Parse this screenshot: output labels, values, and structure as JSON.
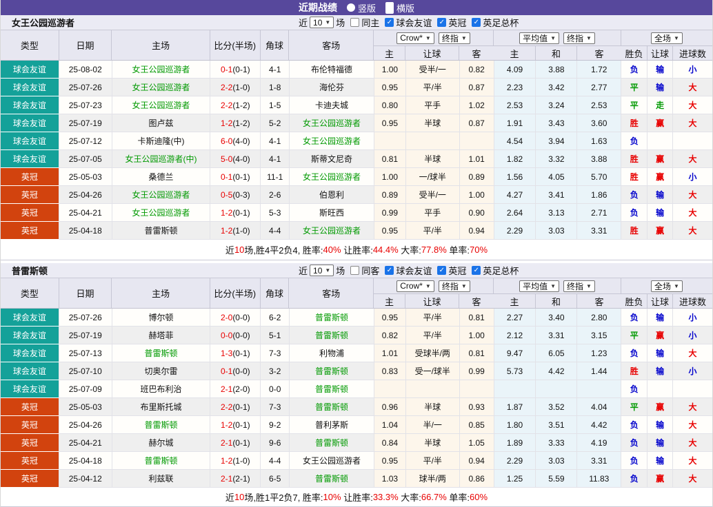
{
  "topbar": {
    "title": "近期战绩",
    "radios": [
      {
        "label": "竖版",
        "selected": false
      },
      {
        "label": "横版",
        "selected": true
      }
    ]
  },
  "columns": {
    "base": [
      "类型",
      "日期",
      "主场",
      "比分(半场)",
      "角球",
      "客场"
    ],
    "odds_group": {
      "dropdown1": "Crow*",
      "dropdown2": "终指",
      "subs": [
        "主",
        "让球",
        "客"
      ]
    },
    "avg_group": {
      "dropdown1": "平均值",
      "dropdown2": "终指",
      "subs": [
        "主",
        "和",
        "客"
      ]
    },
    "result_group": {
      "dropdown": "全场",
      "subs": [
        "胜负",
        "让球",
        "进球数"
      ]
    }
  },
  "colors": {
    "accent_purple": "#57489c",
    "checkbox_blue": "#1a73e8",
    "team_green": "#009900",
    "score_red": "#e80000",
    "badge": {
      "球会友谊": "#14a199",
      "英冠": "#d2430e"
    },
    "result": {
      "胜": "#e80000",
      "平": "#009900",
      "负": "#0000cc",
      "赢": "#e80000",
      "走": "#009900",
      "输": "#0000cc",
      "大": "#e80000",
      "小": "#0000cc"
    }
  },
  "tables": [
    {
      "team": "女王公园巡游者",
      "filter": {
        "prefix": "近",
        "games": "10",
        "suffix": "场",
        "same_label": "同主",
        "same_checked": false,
        "leagues": [
          {
            "label": "球会友谊",
            "checked": true
          },
          {
            "label": "英冠",
            "checked": true
          },
          {
            "label": "英足总杯",
            "checked": true
          }
        ]
      },
      "rows": [
        {
          "type": "球会友谊",
          "date": "25-08-02",
          "home": "女王公园巡游者",
          "home_focus": true,
          "score": "0-1",
          "half": "(0-1)",
          "corner": "4-1",
          "away": "布伦特福德",
          "away_focus": false,
          "crow_home": "1.00",
          "crow_handicap": "受半/一",
          "crow_away": "0.82",
          "avg_home": "4.09",
          "avg_draw": "3.88",
          "avg_away": "1.72",
          "result": "负",
          "handicap_result": "输",
          "goals": "小"
        },
        {
          "type": "球会友谊",
          "date": "25-07-26",
          "home": "女王公园巡游者",
          "home_focus": true,
          "score": "2-2",
          "half": "(1-0)",
          "corner": "1-8",
          "away": "海伦芬",
          "away_focus": false,
          "crow_home": "0.95",
          "crow_handicap": "平/半",
          "crow_away": "0.87",
          "avg_home": "2.23",
          "avg_draw": "3.42",
          "avg_away": "2.77",
          "result": "平",
          "handicap_result": "输",
          "goals": "大"
        },
        {
          "type": "球会友谊",
          "date": "25-07-23",
          "home": "女王公园巡游者",
          "home_focus": true,
          "score": "2-2",
          "half": "(1-2)",
          "corner": "1-5",
          "away": "卡迪夫城",
          "away_focus": false,
          "crow_home": "0.80",
          "crow_handicap": "平手",
          "crow_away": "1.02",
          "avg_home": "2.53",
          "avg_draw": "3.24",
          "avg_away": "2.53",
          "result": "平",
          "handicap_result": "走",
          "goals": "大"
        },
        {
          "type": "球会友谊",
          "date": "25-07-19",
          "home": "图卢兹",
          "home_focus": false,
          "score": "1-2",
          "half": "(1-2)",
          "corner": "5-2",
          "away": "女王公园巡游者",
          "away_focus": true,
          "crow_home": "0.95",
          "crow_handicap": "半球",
          "crow_away": "0.87",
          "avg_home": "1.91",
          "avg_draw": "3.43",
          "avg_away": "3.60",
          "result": "胜",
          "handicap_result": "赢",
          "goals": "大"
        },
        {
          "type": "球会友谊",
          "date": "25-07-12",
          "home": "卡斯迪隆(中)",
          "home_focus": false,
          "score": "6-0",
          "half": "(4-0)",
          "corner": "4-1",
          "away": "女王公园巡游者",
          "away_focus": true,
          "crow_home": "",
          "crow_handicap": "",
          "crow_away": "",
          "avg_home": "4.54",
          "avg_draw": "3.94",
          "avg_away": "1.63",
          "result": "负",
          "handicap_result": "",
          "goals": ""
        },
        {
          "type": "球会友谊",
          "date": "25-07-05",
          "home": "女王公园巡游者(中)",
          "home_focus": true,
          "score": "5-0",
          "half": "(4-0)",
          "corner": "4-1",
          "away": "斯蒂文尼奇",
          "away_focus": false,
          "crow_home": "0.81",
          "crow_handicap": "半球",
          "crow_away": "1.01",
          "avg_home": "1.82",
          "avg_draw": "3.32",
          "avg_away": "3.88",
          "result": "胜",
          "handicap_result": "赢",
          "goals": "大"
        },
        {
          "type": "英冠",
          "date": "25-05-03",
          "home": "桑德兰",
          "home_focus": false,
          "score": "0-1",
          "half": "(0-1)",
          "corner": "11-1",
          "away": "女王公园巡游者",
          "away_focus": true,
          "crow_home": "1.00",
          "crow_handicap": "一/球半",
          "crow_away": "0.89",
          "avg_home": "1.56",
          "avg_draw": "4.05",
          "avg_away": "5.70",
          "result": "胜",
          "handicap_result": "赢",
          "goals": "小"
        },
        {
          "type": "英冠",
          "date": "25-04-26",
          "home": "女王公园巡游者",
          "home_focus": true,
          "score": "0-5",
          "half": "(0-3)",
          "corner": "2-6",
          "away": "伯恩利",
          "away_focus": false,
          "crow_home": "0.89",
          "crow_handicap": "受半/一",
          "crow_away": "1.00",
          "avg_home": "4.27",
          "avg_draw": "3.41",
          "avg_away": "1.86",
          "result": "负",
          "handicap_result": "输",
          "goals": "大"
        },
        {
          "type": "英冠",
          "date": "25-04-21",
          "home": "女王公园巡游者",
          "home_focus": true,
          "score": "1-2",
          "half": "(0-1)",
          "corner": "5-3",
          "away": "斯旺西",
          "away_focus": false,
          "crow_home": "0.99",
          "crow_handicap": "平手",
          "crow_away": "0.90",
          "avg_home": "2.64",
          "avg_draw": "3.13",
          "avg_away": "2.71",
          "result": "负",
          "handicap_result": "输",
          "goals": "大"
        },
        {
          "type": "英冠",
          "date": "25-04-18",
          "home": "普雷斯顿",
          "home_focus": false,
          "score": "1-2",
          "half": "(1-0)",
          "corner": "4-4",
          "away": "女王公园巡游者",
          "away_focus": true,
          "crow_home": "0.95",
          "crow_handicap": "平/半",
          "crow_away": "0.94",
          "avg_home": "2.29",
          "avg_draw": "3.03",
          "avg_away": "3.31",
          "result": "胜",
          "handicap_result": "赢",
          "goals": "大"
        }
      ],
      "summary": [
        {
          "text": "近",
          "red": false
        },
        {
          "text": "10",
          "red": true
        },
        {
          "text": "场,胜4平2负4, 胜率:",
          "red": false
        },
        {
          "text": "40%",
          "red": true
        },
        {
          "text": " 让胜率:",
          "red": false
        },
        {
          "text": "44.4%",
          "red": true
        },
        {
          "text": " 大率:",
          "red": false
        },
        {
          "text": "77.8%",
          "red": true
        },
        {
          "text": " 单率:",
          "red": false
        },
        {
          "text": "70%",
          "red": true
        }
      ]
    },
    {
      "team": "普雷斯顿",
      "filter": {
        "prefix": "近",
        "games": "10",
        "suffix": "场",
        "same_label": "同客",
        "same_checked": false,
        "leagues": [
          {
            "label": "球会友谊",
            "checked": true
          },
          {
            "label": "英冠",
            "checked": true
          },
          {
            "label": "英足总杯",
            "checked": true
          }
        ]
      },
      "rows": [
        {
          "type": "球会友谊",
          "date": "25-07-26",
          "home": "博尔顿",
          "home_focus": false,
          "score": "2-0",
          "half": "(0-0)",
          "corner": "6-2",
          "away": "普雷斯顿",
          "away_focus": true,
          "crow_home": "0.95",
          "crow_handicap": "平/半",
          "crow_away": "0.81",
          "avg_home": "2.27",
          "avg_draw": "3.40",
          "avg_away": "2.80",
          "result": "负",
          "handicap_result": "输",
          "goals": "小"
        },
        {
          "type": "球会友谊",
          "date": "25-07-19",
          "home": "赫塔菲",
          "home_focus": false,
          "score": "0-0",
          "half": "(0-0)",
          "corner": "5-1",
          "away": "普雷斯顿",
          "away_focus": true,
          "crow_home": "0.82",
          "crow_handicap": "平/半",
          "crow_away": "1.00",
          "avg_home": "2.12",
          "avg_draw": "3.31",
          "avg_away": "3.15",
          "result": "平",
          "handicap_result": "赢",
          "goals": "小"
        },
        {
          "type": "球会友谊",
          "date": "25-07-13",
          "home": "普雷斯顿",
          "home_focus": true,
          "score": "1-3",
          "half": "(0-1)",
          "corner": "7-3",
          "away": "利物浦",
          "away_focus": false,
          "crow_home": "1.01",
          "crow_handicap": "受球半/两",
          "crow_away": "0.81",
          "avg_home": "9.47",
          "avg_draw": "6.05",
          "avg_away": "1.23",
          "result": "负",
          "handicap_result": "输",
          "goals": "大"
        },
        {
          "type": "球会友谊",
          "date": "25-07-10",
          "home": "切奥尔雷",
          "home_focus": false,
          "score": "0-1",
          "half": "(0-0)",
          "corner": "3-2",
          "away": "普雷斯顿",
          "away_focus": true,
          "crow_home": "0.83",
          "crow_handicap": "受一/球半",
          "crow_away": "0.99",
          "avg_home": "5.73",
          "avg_draw": "4.42",
          "avg_away": "1.44",
          "result": "胜",
          "handicap_result": "输",
          "goals": "小"
        },
        {
          "type": "球会友谊",
          "date": "25-07-09",
          "home": "班巴布利治",
          "home_focus": false,
          "score": "2-1",
          "half": "(2-0)",
          "corner": "0-0",
          "away": "普雷斯顿",
          "away_focus": true,
          "crow_home": "",
          "crow_handicap": "",
          "crow_away": "",
          "avg_home": "",
          "avg_draw": "",
          "avg_away": "",
          "result": "负",
          "handicap_result": "",
          "goals": ""
        },
        {
          "type": "英冠",
          "date": "25-05-03",
          "home": "布里斯托城",
          "home_focus": false,
          "score": "2-2",
          "half": "(0-1)",
          "corner": "7-3",
          "away": "普雷斯顿",
          "away_focus": true,
          "crow_home": "0.96",
          "crow_handicap": "半球",
          "crow_away": "0.93",
          "avg_home": "1.87",
          "avg_draw": "3.52",
          "avg_away": "4.04",
          "result": "平",
          "handicap_result": "赢",
          "goals": "大"
        },
        {
          "type": "英冠",
          "date": "25-04-26",
          "home": "普雷斯顿",
          "home_focus": true,
          "score": "1-2",
          "half": "(0-1)",
          "corner": "9-2",
          "away": "普利茅斯",
          "away_focus": false,
          "crow_home": "1.04",
          "crow_handicap": "半/一",
          "crow_away": "0.85",
          "avg_home": "1.80",
          "avg_draw": "3.51",
          "avg_away": "4.42",
          "result": "负",
          "handicap_result": "输",
          "goals": "大"
        },
        {
          "type": "英冠",
          "date": "25-04-21",
          "home": "赫尔城",
          "home_focus": false,
          "score": "2-1",
          "half": "(0-1)",
          "corner": "9-6",
          "away": "普雷斯顿",
          "away_focus": true,
          "crow_home": "0.84",
          "crow_handicap": "半球",
          "crow_away": "1.05",
          "avg_home": "1.89",
          "avg_draw": "3.33",
          "avg_away": "4.19",
          "result": "负",
          "handicap_result": "输",
          "goals": "大"
        },
        {
          "type": "英冠",
          "date": "25-04-18",
          "home": "普雷斯顿",
          "home_focus": true,
          "score": "1-2",
          "half": "(1-0)",
          "corner": "4-4",
          "away": "女王公园巡游者",
          "away_focus": false,
          "crow_home": "0.95",
          "crow_handicap": "平/半",
          "crow_away": "0.94",
          "avg_home": "2.29",
          "avg_draw": "3.03",
          "avg_away": "3.31",
          "result": "负",
          "handicap_result": "输",
          "goals": "大"
        },
        {
          "type": "英冠",
          "date": "25-04-12",
          "home": "利兹联",
          "home_focus": false,
          "score": "2-1",
          "half": "(2-1)",
          "corner": "6-5",
          "away": "普雷斯顿",
          "away_focus": true,
          "crow_home": "1.03",
          "crow_handicap": "球半/两",
          "crow_away": "0.86",
          "avg_home": "1.25",
          "avg_draw": "5.59",
          "avg_away": "11.83",
          "result": "负",
          "handicap_result": "赢",
          "goals": "大"
        }
      ],
      "summary": [
        {
          "text": "近",
          "red": false
        },
        {
          "text": "10",
          "red": true
        },
        {
          "text": "场,胜1平2负7, 胜率:",
          "red": false
        },
        {
          "text": "10%",
          "red": true
        },
        {
          "text": " 让胜率:",
          "red": false
        },
        {
          "text": "33.3%",
          "red": true
        },
        {
          "text": " 大率:",
          "red": false
        },
        {
          "text": "66.7%",
          "red": true
        },
        {
          "text": " 单率:",
          "red": false
        },
        {
          "text": "60%",
          "red": true
        }
      ]
    }
  ]
}
